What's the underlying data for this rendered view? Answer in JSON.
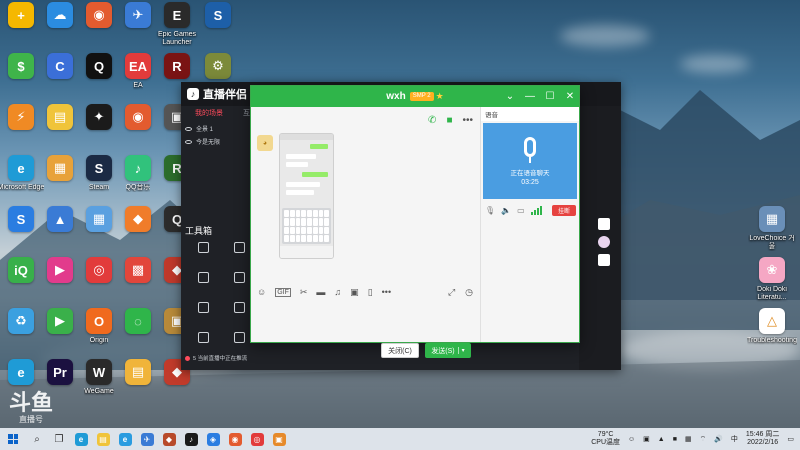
{
  "desktop": {
    "icons": [
      {
        "label": "",
        "color": "#f5b800",
        "glyph": "+"
      },
      {
        "label": "",
        "color": "#2b8ce0",
        "glyph": "☁"
      },
      {
        "label": "",
        "color": "#e35b2f",
        "glyph": "◉"
      },
      {
        "label": "",
        "color": "#3a7bd5",
        "glyph": "✈"
      },
      {
        "label": "Epic Games Launcher",
        "color": "#2a2a2a",
        "glyph": "E"
      },
      {
        "label": "",
        "color": "#1d5fa8",
        "glyph": "S"
      },
      {
        "label": "",
        "color": "#3fb44a",
        "glyph": "$"
      },
      {
        "label": "",
        "color": "#3b6fd8",
        "glyph": "C"
      },
      {
        "label": "",
        "color": "#111111",
        "glyph": "Q"
      },
      {
        "label": "EA",
        "color": "#e23b3b",
        "glyph": "EA"
      },
      {
        "label": "",
        "color": "#7a1414",
        "glyph": "R"
      },
      {
        "label": "",
        "color": "#7c8a3a",
        "glyph": "⚙"
      },
      {
        "label": "",
        "color": "#f08a24",
        "glyph": "⚡"
      },
      {
        "label": "",
        "color": "#f0c43a",
        "glyph": "▤"
      },
      {
        "label": "",
        "color": "#1b1b1b",
        "glyph": "✦"
      },
      {
        "label": "",
        "color": "#e35b2f",
        "glyph": "◉"
      },
      {
        "label": "",
        "color": "#555555",
        "glyph": "▣"
      },
      {
        "label": "Microsoft Edge",
        "color": "#1f9bd6",
        "glyph": "e"
      },
      {
        "label": "",
        "color": "#e8a23a",
        "glyph": "▦"
      },
      {
        "label": "Steam",
        "color": "#1b2a44",
        "glyph": "S"
      },
      {
        "label": "QQ音乐",
        "color": "#31c27c",
        "glyph": "♪"
      },
      {
        "label": "",
        "color": "#2c6d2c",
        "glyph": "R"
      },
      {
        "label": "",
        "color": "#2a7de1",
        "glyph": "S"
      },
      {
        "label": "",
        "color": "#3a7bd5",
        "glyph": "▲"
      },
      {
        "label": "",
        "color": "#5aa0e0",
        "glyph": "▦"
      },
      {
        "label": "",
        "color": "#f07c2a",
        "glyph": "◆"
      },
      {
        "label": "",
        "color": "#2c2c2c",
        "glyph": "Q"
      },
      {
        "label": "",
        "color": "#38b04a",
        "glyph": "iQ"
      },
      {
        "label": "",
        "color": "#e23b8c",
        "glyph": "▶"
      },
      {
        "label": "",
        "color": "#e23b3b",
        "glyph": "◎"
      },
      {
        "label": "",
        "color": "#e2463b",
        "glyph": "▩"
      },
      {
        "label": "",
        "color": "#c0392b",
        "glyph": "◆"
      },
      {
        "label": "",
        "color": "#3ba0e0",
        "glyph": "♻"
      },
      {
        "label": "",
        "color": "#3ab04a",
        "glyph": "▶"
      },
      {
        "label": "Origin",
        "color": "#f06a1e",
        "glyph": "O"
      },
      {
        "label": "",
        "color": "#2fb54a",
        "glyph": "◌"
      },
      {
        "label": "",
        "color": "#b88a3a",
        "glyph": "▣"
      },
      {
        "label": "",
        "color": "#1f9bd6",
        "glyph": "e"
      },
      {
        "label": "",
        "color": "#1b1140",
        "glyph": "Pr"
      },
      {
        "label": "WeGame",
        "color": "#2a2a2a",
        "glyph": "W"
      },
      {
        "label": "",
        "color": "#f0b43a",
        "glyph": "▤"
      },
      {
        "label": "",
        "color": "#c23b2b",
        "glyph": "◆"
      }
    ],
    "right_icons": [
      {
        "label": "LoveChoice 거울",
        "color": "#6a8fb8",
        "glyph": "▦"
      },
      {
        "label": "Doki Doki Literatu...",
        "color": "#f5a7c4",
        "glyph": "❀"
      },
      {
        "label": "Troubleshooting",
        "color": "#ffffff",
        "glyph": "△"
      }
    ]
  },
  "live_app": {
    "logo": "直播伴侣",
    "tabs": [
      "我的场景",
      "",
      "互"
    ],
    "scenes": [
      "全景 1",
      "今是无限"
    ],
    "tools_title": "工具箱",
    "tools": [
      "",
      "",
      "",
      "",
      "",
      "",
      "",
      ""
    ],
    "status_line": "5 当前直播中正在推流"
  },
  "chat": {
    "title": "wxh",
    "badge": "SMP 2",
    "controls": [
      "⌄",
      "—",
      "☐",
      "✕"
    ],
    "input_value": "",
    "close_label": "关闭(C)",
    "send_label": "发送(S)",
    "call_panel_title": "语音",
    "call_status": "正在语音聊天",
    "call_timer": "03:25",
    "hangup_label": "挂断"
  },
  "watermark": {
    "big": "斗鱼",
    "small": "直播号"
  },
  "taskbar": {
    "weather_temp": "79°C",
    "weather_label": "CPU温度",
    "time": "15:46 周二",
    "date": "2022/2/16",
    "lang": "中"
  }
}
